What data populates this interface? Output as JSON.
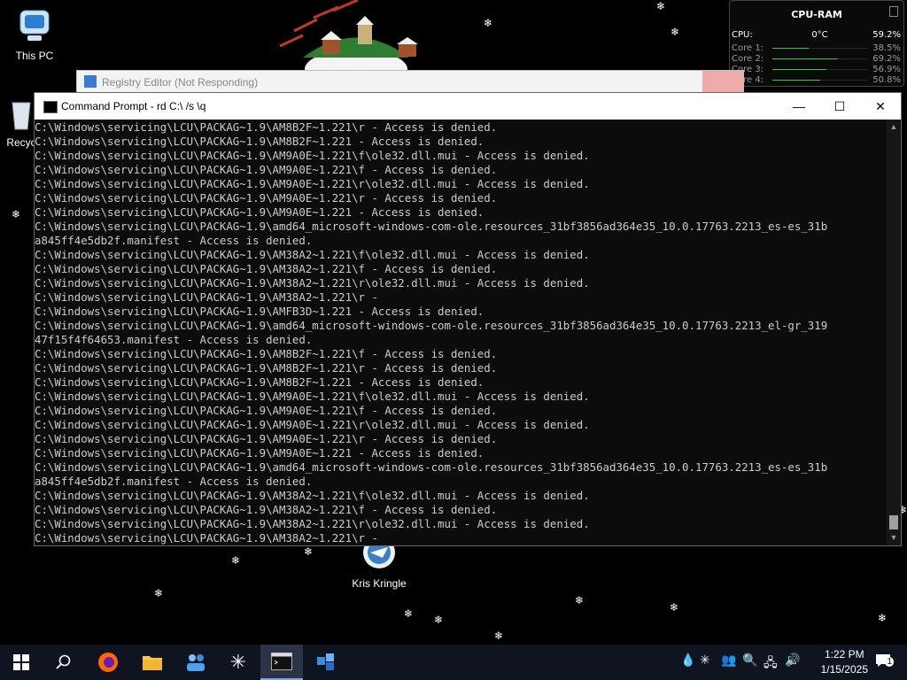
{
  "desktop": {
    "icons": [
      {
        "label": "This PC"
      },
      {
        "label": "Recyc"
      },
      {
        "label": "Kris Kringle"
      }
    ]
  },
  "gadget": {
    "title": "CPU-RAM",
    "cpu_label": "CPU:",
    "temp": "0°C",
    "cpu_pct": "59.2%",
    "cores": [
      {
        "label": "Core 1:",
        "pct": "38.5%",
        "value": 38.5
      },
      {
        "label": "Core 2:",
        "pct": "69.2%",
        "value": 69.2
      },
      {
        "label": "Core 3:",
        "pct": "56.9%",
        "value": 56.9
      },
      {
        "label": "Core 4:",
        "pct": "50.8%",
        "value": 50.8
      }
    ]
  },
  "regedit": {
    "title": "Registry Editor (Not Responding)"
  },
  "cmd": {
    "title": "Command Prompt - rd  C:\\ /s \\q",
    "minimize": "—",
    "maximize": "☐",
    "close": "✕",
    "lines": [
      "C:\\Windows\\servicing\\LCU\\PACKAG~1.9\\AM8B2F~1.221\\r - Access is denied.",
      "C:\\Windows\\servicing\\LCU\\PACKAG~1.9\\AM8B2F~1.221 - Access is denied.",
      "C:\\Windows\\servicing\\LCU\\PACKAG~1.9\\AM9A0E~1.221\\f\\ole32.dll.mui - Access is denied.",
      "C:\\Windows\\servicing\\LCU\\PACKAG~1.9\\AM9A0E~1.221\\f - Access is denied.",
      "C:\\Windows\\servicing\\LCU\\PACKAG~1.9\\AM9A0E~1.221\\r\\ole32.dll.mui - Access is denied.",
      "C:\\Windows\\servicing\\LCU\\PACKAG~1.9\\AM9A0E~1.221\\r - Access is denied.",
      "C:\\Windows\\servicing\\LCU\\PACKAG~1.9\\AM9A0E~1.221 - Access is denied.",
      "C:\\Windows\\servicing\\LCU\\PACKAG~1.9\\amd64_microsoft-windows-com-ole.resources_31bf3856ad364e35_10.0.17763.2213_es-es_31b",
      "a845ff4e5db2f.manifest - Access is denied.",
      "C:\\Windows\\servicing\\LCU\\PACKAG~1.9\\AM38A2~1.221\\f\\ole32.dll.mui - Access is denied.",
      "C:\\Windows\\servicing\\LCU\\PACKAG~1.9\\AM38A2~1.221\\f - Access is denied.",
      "C:\\Windows\\servicing\\LCU\\PACKAG~1.9\\AM38A2~1.221\\r\\ole32.dll.mui - Access is denied.",
      "C:\\Windows\\servicing\\LCU\\PACKAG~1.9\\AM38A2~1.221\\r - ",
      "C:\\Windows\\servicing\\LCU\\PACKAG~1.9\\AMFB3D~1.221 - Access is denied.",
      "C:\\Windows\\servicing\\LCU\\PACKAG~1.9\\amd64_microsoft-windows-com-ole.resources_31bf3856ad364e35_10.0.17763.2213_el-gr_319",
      "47f15f4f64653.manifest - Access is denied.",
      "C:\\Windows\\servicing\\LCU\\PACKAG~1.9\\AM8B2F~1.221\\f - Access is denied.",
      "C:\\Windows\\servicing\\LCU\\PACKAG~1.9\\AM8B2F~1.221\\r - Access is denied.",
      "C:\\Windows\\servicing\\LCU\\PACKAG~1.9\\AM8B2F~1.221 - Access is denied.",
      "C:\\Windows\\servicing\\LCU\\PACKAG~1.9\\AM9A0E~1.221\\f\\ole32.dll.mui - Access is denied.",
      "C:\\Windows\\servicing\\LCU\\PACKAG~1.9\\AM9A0E~1.221\\f - Access is denied.",
      "C:\\Windows\\servicing\\LCU\\PACKAG~1.9\\AM9A0E~1.221\\r\\ole32.dll.mui - Access is denied.",
      "C:\\Windows\\servicing\\LCU\\PACKAG~1.9\\AM9A0E~1.221\\r - Access is denied.",
      "C:\\Windows\\servicing\\LCU\\PACKAG~1.9\\AM9A0E~1.221 - Access is denied.",
      "C:\\Windows\\servicing\\LCU\\PACKAG~1.9\\amd64_microsoft-windows-com-ole.resources_31bf3856ad364e35_10.0.17763.2213_es-es_31b",
      "a845ff4e5db2f.manifest - Access is denied.",
      "C:\\Windows\\servicing\\LCU\\PACKAG~1.9\\AM38A2~1.221\\f\\ole32.dll.mui - Access is denied.",
      "C:\\Windows\\servicing\\LCU\\PACKAG~1.9\\AM38A2~1.221\\f - Access is denied.",
      "C:\\Windows\\servicing\\LCU\\PACKAG~1.9\\AM38A2~1.221\\r\\ole32.dll.mui - Access is denied.",
      "C:\\Windows\\servicing\\LCU\\PACKAG~1.9\\AM38A2~1.221\\r - "
    ]
  },
  "taskbar": {
    "time": "1:22 PM",
    "date": "1/15/2025",
    "notification_count": "1"
  }
}
